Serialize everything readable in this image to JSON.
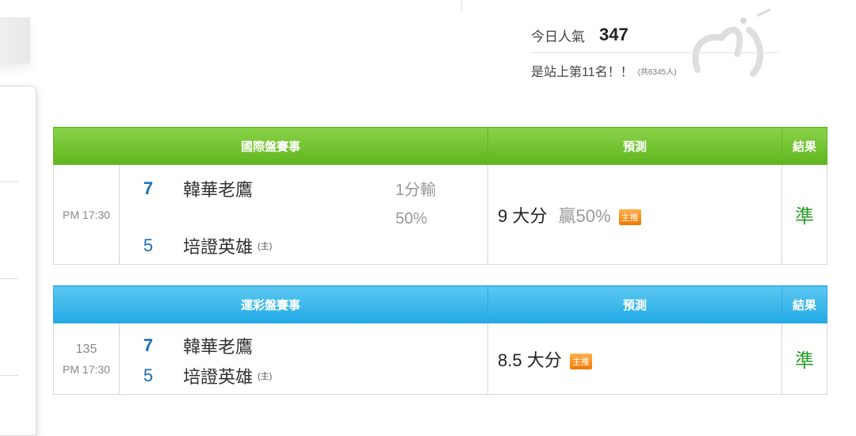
{
  "popularity": {
    "label": "今日人氣",
    "count": "347",
    "rank_text": "是站上第11名！！",
    "total_text": "(共6345人)"
  },
  "tables": [
    {
      "header": {
        "event": "國際盤賽事",
        "prediction": "預測",
        "result": "結果"
      },
      "header_color": "#6cc02a",
      "row": {
        "code": "",
        "time": "PM 17:30",
        "away_score": "7",
        "away_team": "韓華老鷹",
        "home_score": "5",
        "home_team": "培證英雄",
        "host_mark": "(主)",
        "odds_line1": "1分輸",
        "odds_line2": "50%",
        "pick": "9 大分",
        "win_rate": "贏50%",
        "badge": "主推",
        "result": "準"
      }
    },
    {
      "header": {
        "event": "運彩盤賽事",
        "prediction": "預測",
        "result": "結果"
      },
      "header_color": "#2aace8",
      "row": {
        "code": "135",
        "time": "PM 17:30",
        "away_score": "7",
        "away_team": "韓華老鷹",
        "home_score": "5",
        "home_team": "培證英雄",
        "host_mark": "(主)",
        "pick": "8.5 大分",
        "badge": "主推",
        "result": "準"
      }
    }
  ]
}
